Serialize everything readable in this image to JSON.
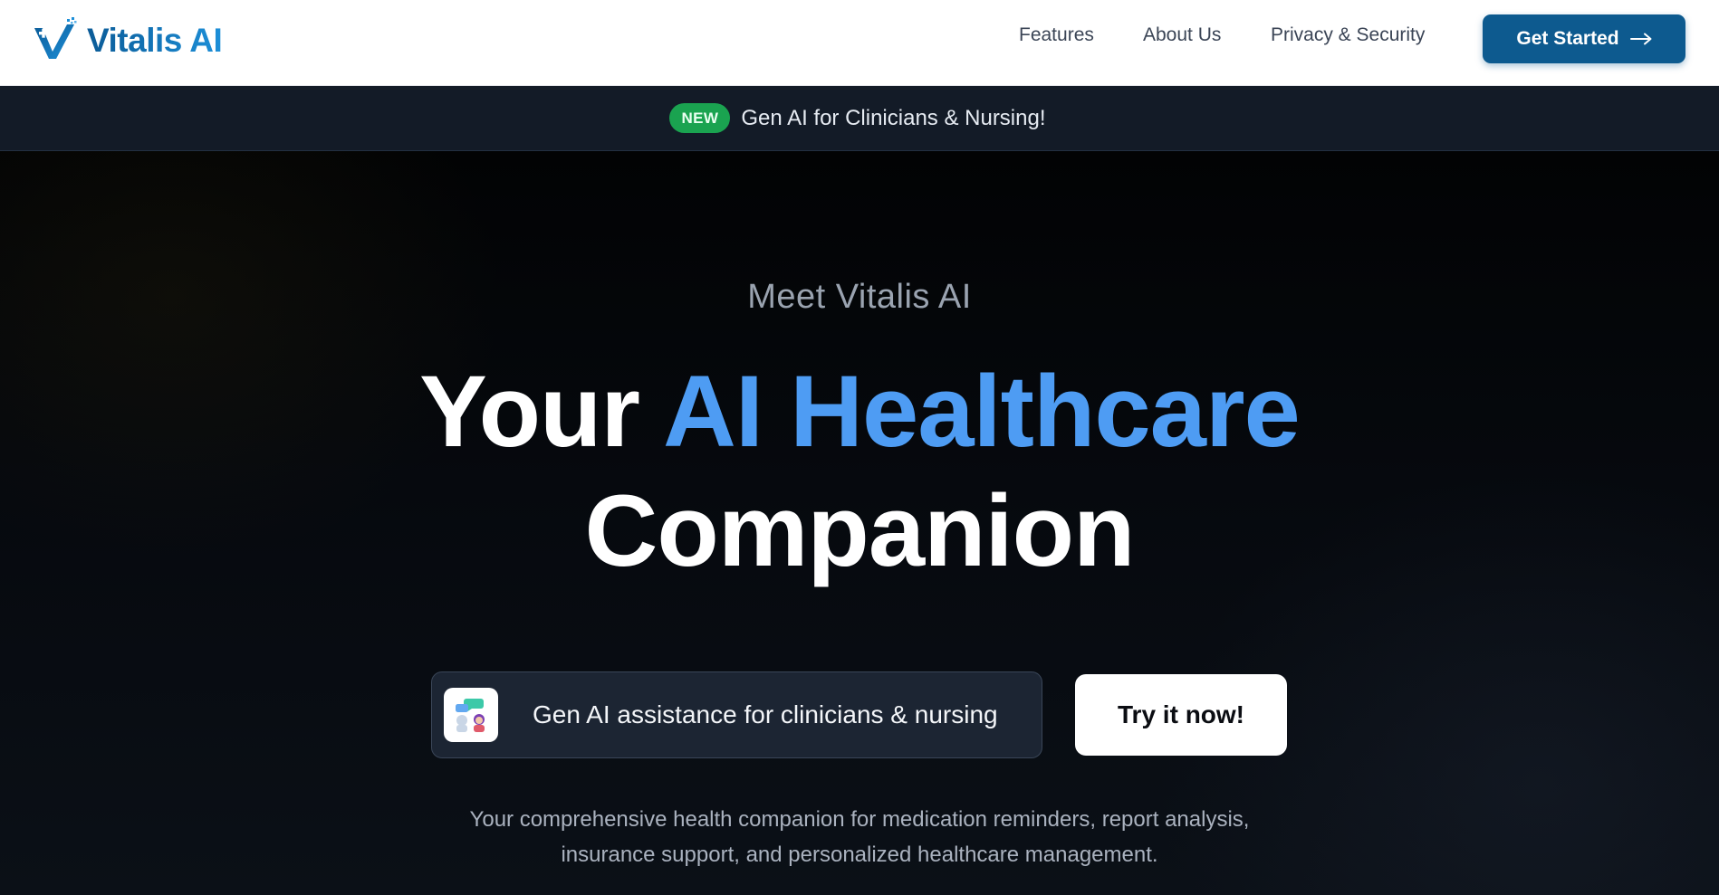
{
  "header": {
    "brand": "Vitalis AI",
    "nav": [
      "Features",
      "About Us",
      "Privacy & Security"
    ],
    "cta_label": "Get Started",
    "colors": {
      "brand_primary": "#0d5a8f",
      "brand_light": "#1d8fd8"
    }
  },
  "announcement": {
    "badge": "NEW",
    "text": "Gen AI for Clinicians & Nursing!",
    "colors": {
      "badge": "#1aa350"
    }
  },
  "hero": {
    "eyebrow": "Meet Vitalis AI",
    "headline_prefix": "Your",
    "headline_accent": "AI Healthcare",
    "headline_suffix": "Companion",
    "feature_pill": {
      "icon": "clinician-chat-icon",
      "text": "Gen AI assistance for clinicians & nursing"
    },
    "try_label": "Try it now!",
    "subcopy_line1": "Your comprehensive health companion for medication reminders, report analysis,",
    "subcopy_line2": "insurance support, and personalized healthcare management.",
    "colors": {
      "accent": "#4e9cf3"
    }
  }
}
